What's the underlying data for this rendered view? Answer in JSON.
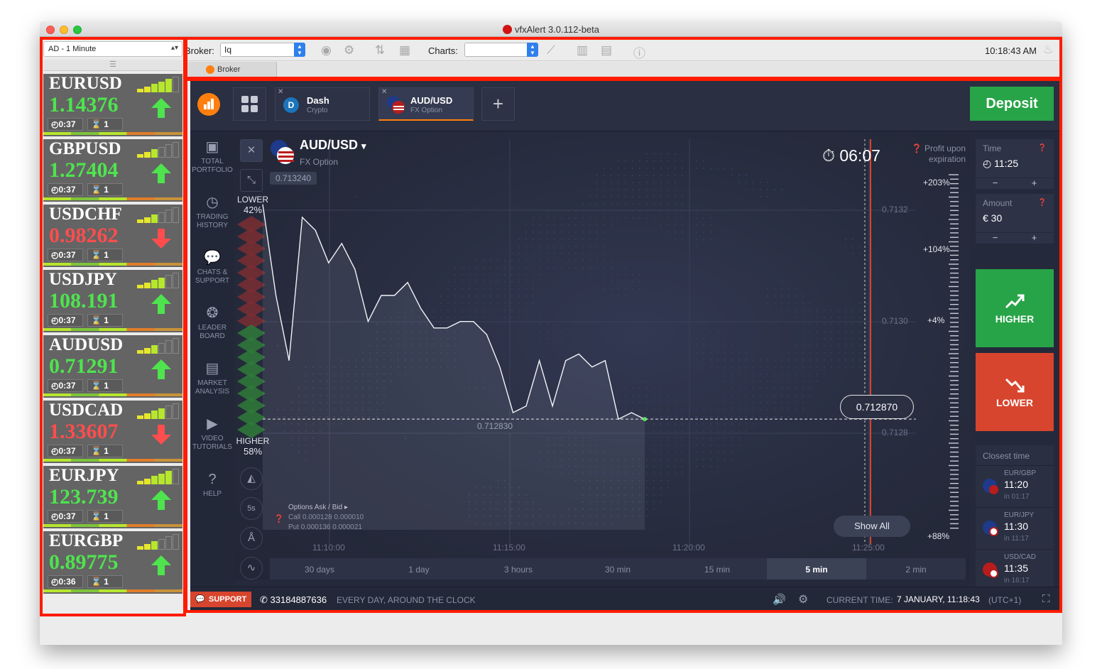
{
  "window": {
    "title": "vfxAlert 3.0.112-beta"
  },
  "rail": {
    "timeframe": "AD - 1 Minute",
    "cards": [
      {
        "symbol": "EURUSD",
        "price": "1.14376",
        "direction": "up",
        "timer": "0:37",
        "expiry": "1",
        "strength": 5
      },
      {
        "symbol": "GBPUSD",
        "price": "1.27404",
        "direction": "up",
        "timer": "0:37",
        "expiry": "1",
        "strength": 3
      },
      {
        "symbol": "USDCHF",
        "price": "0.98262",
        "direction": "down",
        "timer": "0:37",
        "expiry": "1",
        "strength": 3
      },
      {
        "symbol": "USDJPY",
        "price": "108.191",
        "direction": "up",
        "timer": "0:37",
        "expiry": "1",
        "strength": 4
      },
      {
        "symbol": "AUDUSD",
        "price": "0.71291",
        "direction": "up",
        "timer": "0:37",
        "expiry": "1",
        "strength": 3
      },
      {
        "symbol": "USDCAD",
        "price": "1.33607",
        "direction": "down",
        "timer": "0:37",
        "expiry": "1",
        "strength": 4
      },
      {
        "symbol": "EURJPY",
        "price": "123.739",
        "direction": "up",
        "timer": "0:37",
        "expiry": "1",
        "strength": 5
      },
      {
        "symbol": "EURGBP",
        "price": "0.89775",
        "direction": "up",
        "timer": "0:36",
        "expiry": "1",
        "strength": 3
      }
    ]
  },
  "toolbar": {
    "broker_label": "Broker:",
    "broker_value": "Iq",
    "charts_label": "Charts:",
    "charts_value": "",
    "clock": "10:18:43 AM",
    "tab": "Broker"
  },
  "app": {
    "tabs": [
      {
        "name": "Dash",
        "sub": "Crypto"
      },
      {
        "name": "AUD/USD",
        "sub": "FX Option"
      }
    ],
    "deposit": "Deposit",
    "nav": [
      {
        "icon": "briefcase-icon",
        "label": "TOTAL PORTFOLIO"
      },
      {
        "icon": "history-icon",
        "label": "TRADING HISTORY"
      },
      {
        "icon": "chat-icon",
        "label": "CHATS & SUPPORT"
      },
      {
        "icon": "medal-icon",
        "label": "LEADER BOARD"
      },
      {
        "icon": "news-icon",
        "label": "MARKET ANALYSIS"
      },
      {
        "icon": "play-icon",
        "label": "VIDEO TUTORIALS"
      },
      {
        "icon": "help-icon",
        "label": "HELP"
      }
    ],
    "asset": {
      "name": "AUD/USD",
      "type": "FX Option"
    },
    "countdown": "06:07",
    "profit_note": "Profit upon expiration",
    "sentiment": {
      "lower_label": "LOWER",
      "lower_pct": "42%",
      "higher_label": "HIGHER",
      "higher_pct": "58%"
    },
    "payouts": [
      "+203%",
      "+104%",
      "+4%",
      "+88%"
    ],
    "prices": {
      "high": "0.713240",
      "low": "0.712830",
      "current": "0.712870"
    },
    "y_ticks": [
      "0.7132",
      "0.7130",
      "0.7128"
    ],
    "x_ticks": [
      "11:10:00",
      "11:15:00",
      "11:20:00",
      "11:25:00"
    ],
    "options": {
      "title": "Options Ask / Bid",
      "call": "Call  0.000128  0.000010",
      "put": "Put  0.000136  0.000021"
    },
    "show_all": "Show All",
    "periods": [
      "30 days",
      "1 day",
      "3 hours",
      "30 min",
      "15 min",
      "5 min",
      "2 min"
    ],
    "active_period": "5 min",
    "time_box": {
      "label": "Time",
      "value": "11:25"
    },
    "amount_box": {
      "label": "Amount",
      "value": "€  30"
    },
    "higher": "HIGHER",
    "lower": "LOWER",
    "closest": {
      "title": "Closest time",
      "rows": [
        {
          "pair": "EUR/GBP",
          "time": "11:20",
          "in": "in 01:17"
        },
        {
          "pair": "EUR/JPY",
          "time": "11:30",
          "in": "in 11:17"
        },
        {
          "pair": "USD/CAD",
          "time": "11:35",
          "in": "in 16:17"
        }
      ]
    },
    "footer": {
      "support": "SUPPORT",
      "phone": "33184887636",
      "hours": "EVERY DAY, AROUND THE CLOCK",
      "current_label": "CURRENT TIME:",
      "current_value": "7 JANUARY, 11:18:43",
      "tz": "(UTC+1)"
    }
  },
  "chart_data": {
    "type": "line",
    "x": [
      "11:09:00",
      "11:09:20",
      "11:09:40",
      "11:10:00",
      "11:10:20",
      "11:10:40",
      "11:11:00",
      "11:11:20",
      "11:11:40",
      "11:12:00",
      "11:12:20",
      "11:12:40",
      "11:13:00",
      "11:13:20",
      "11:13:40",
      "11:14:00",
      "11:14:20",
      "11:14:40",
      "11:15:00",
      "11:15:20",
      "11:15:40",
      "11:16:00",
      "11:16:20",
      "11:16:40",
      "11:17:00",
      "11:17:20",
      "11:17:40",
      "11:18:00",
      "11:18:20",
      "11:18:43"
    ],
    "values": [
      0.7132,
      0.71306,
      0.71296,
      0.71318,
      0.71316,
      0.71311,
      0.71314,
      0.7131,
      0.71302,
      0.71306,
      0.71306,
      0.71308,
      0.71304,
      0.71301,
      0.71301,
      0.71302,
      0.71302,
      0.713,
      0.71295,
      0.71288,
      0.71289,
      0.71296,
      0.71289,
      0.71296,
      0.71297,
      0.71295,
      0.71296,
      0.71287,
      0.71288,
      0.71287
    ],
    "ylim": [
      0.7127,
      0.7133
    ],
    "current_price": 0.71287
  },
  "colors": {
    "up": "#4ee44e",
    "down": "#ff4d4d",
    "deposit": "#27a447",
    "lower": "#d8452e",
    "highlight": "#ff1b00"
  }
}
